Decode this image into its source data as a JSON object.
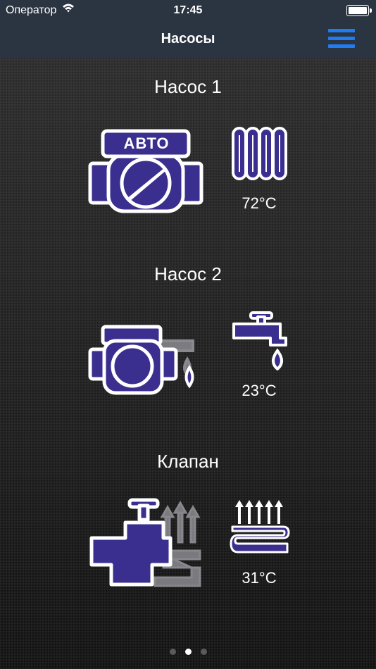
{
  "status": {
    "carrier": "Оператор",
    "time": "17:45",
    "icons": [
      "wifi-icon",
      "battery-icon"
    ]
  },
  "nav": {
    "title": "Насосы",
    "menu_icon": "hamburger-menu-icon"
  },
  "sections": [
    {
      "title": "Насос 1",
      "badge": "АВТО",
      "temperature": "72°C",
      "device_icon": "auto-pump-icon",
      "sensor_icon": "radiator-icon"
    },
    {
      "title": "Насос 2",
      "temperature": "23°C",
      "device_icon": "pump-with-tap-icon",
      "sensor_icon": "water-tap-icon"
    },
    {
      "title": "Клапан",
      "temperature": "31°C",
      "device_icon": "valve-floor-heating-icon",
      "sensor_icon": "floor-heating-icon"
    }
  ],
  "pager": {
    "count": 3,
    "active": 2
  },
  "colors": {
    "bar": "#2b3441",
    "accent": "#1f7cf2",
    "icon_fill": "#3a2f8f",
    "icon_outline": "#ffffff"
  }
}
